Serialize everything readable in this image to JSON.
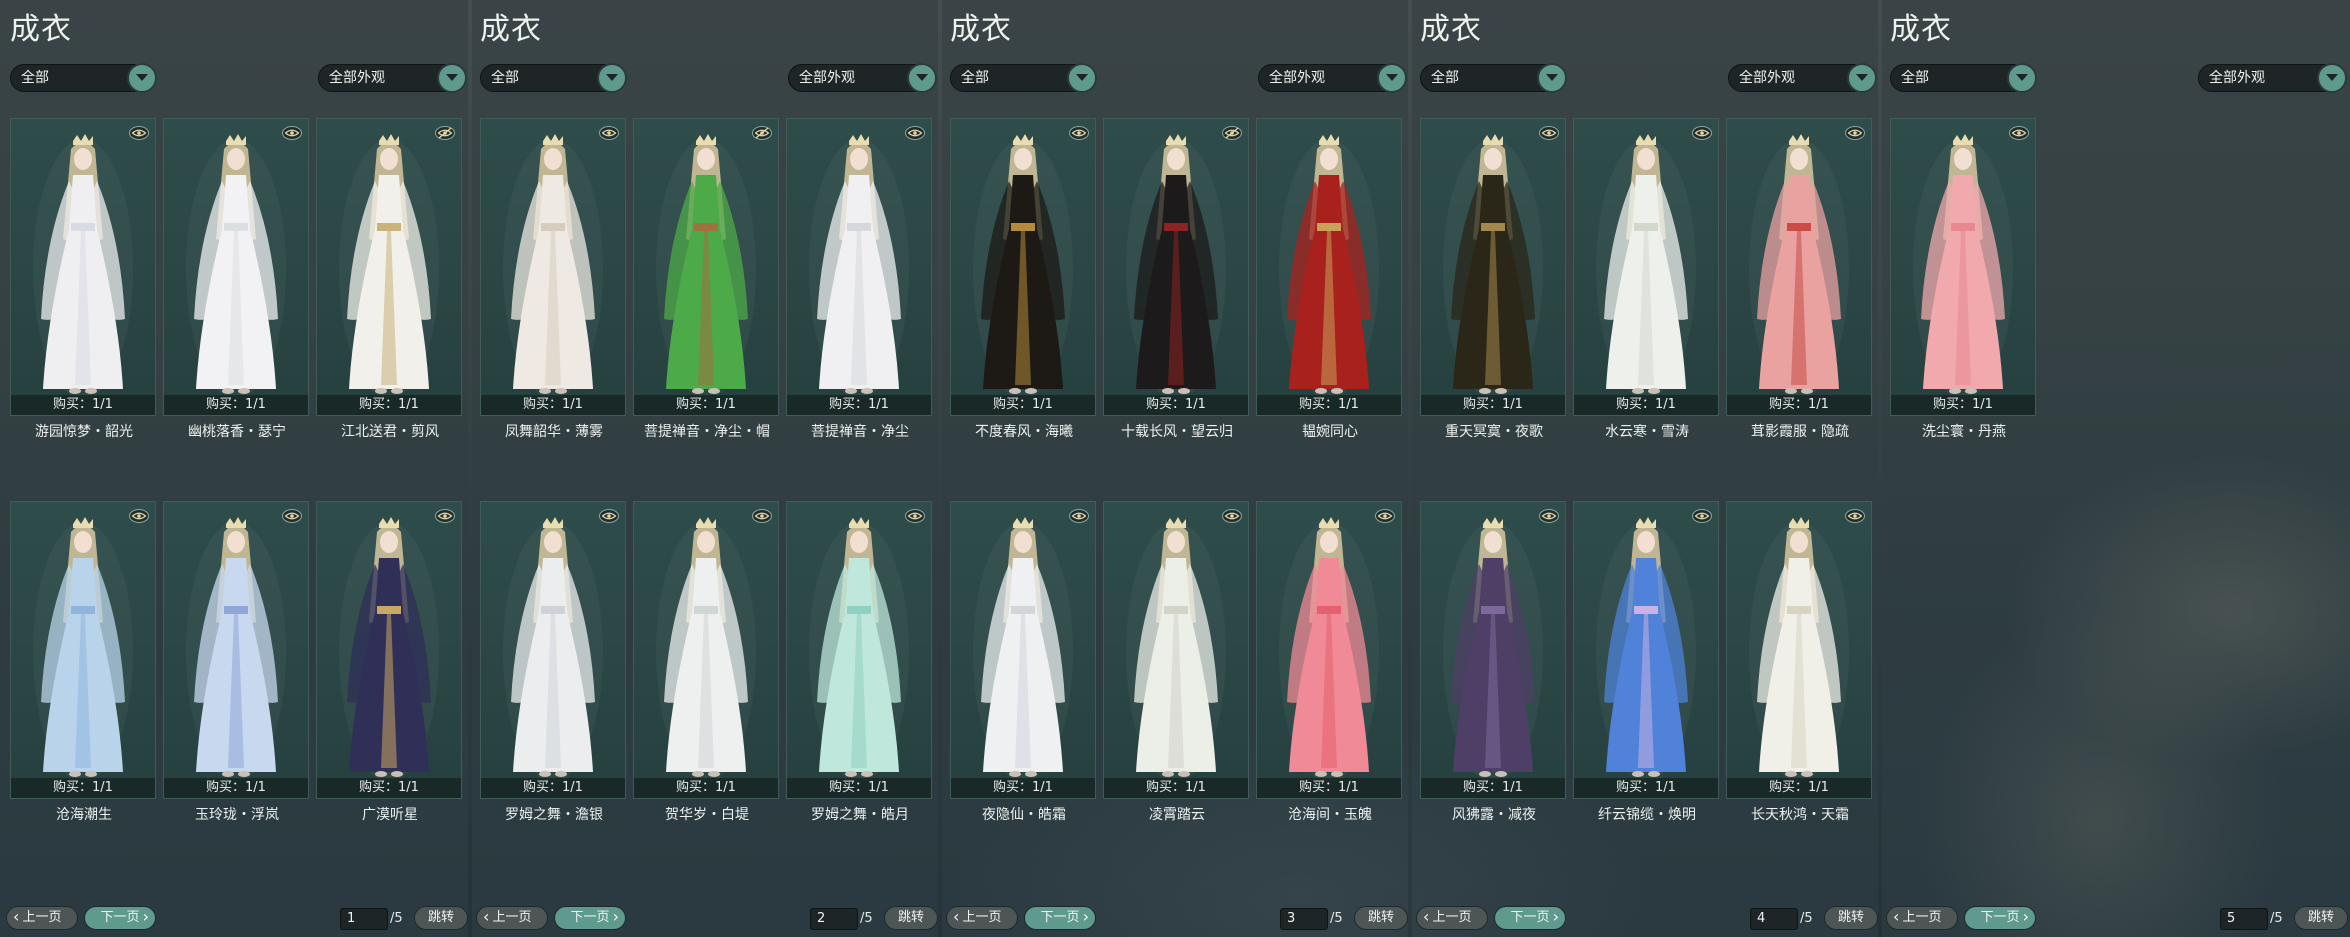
{
  "colors": {
    "accent": "#5f9a8f",
    "card_bg": "#2a4644",
    "background": "#2f3d42"
  },
  "pages": [
    {
      "title": "成衣",
      "filter_left": "全部",
      "filter_right": "全部外观",
      "prev_label": "上一页",
      "next_label": "下一页",
      "page_current": "1",
      "page_total": "/5",
      "jump_label": "跳转",
      "items": [
        {
          "name": "游园惊梦・韶光",
          "buy": "购买：1/1",
          "icon": "eye-icon",
          "palette": [
            "#efeff2",
            "#d9dbe4"
          ]
        },
        {
          "name": "幽桃落香・瑟宁",
          "buy": "购买：1/1",
          "icon": "eye-icon",
          "palette": [
            "#f2f2f4",
            "#dcdfe2"
          ]
        },
        {
          "name": "江北送君・剪风",
          "buy": "购买：1/1",
          "icon": "eye-crossed-icon",
          "palette": [
            "#f1f0ea",
            "#c8b37a"
          ]
        },
        {
          "name": "沧海潮生",
          "buy": "购买：1/1",
          "icon": "eye-icon",
          "palette": [
            "#b9d4ea",
            "#8fb5dc"
          ]
        },
        {
          "name": "玉玲珑・浮岚",
          "buy": "购买：1/1",
          "icon": "eye-icon",
          "palette": [
            "#c8d8ef",
            "#8ea7d6"
          ]
        },
        {
          "name": "广漠听星",
          "buy": "购买：1/1",
          "icon": "eye-icon",
          "palette": [
            "#2f2f58",
            "#c9a865"
          ]
        }
      ]
    },
    {
      "title": "成衣",
      "filter_left": "全部",
      "filter_right": "全部外观",
      "prev_label": "上一页",
      "next_label": "下一页",
      "page_current": "2",
      "page_total": "/5",
      "jump_label": "跳转",
      "items": [
        {
          "name": "凤舞韶华・薄雾",
          "buy": "购买：1/1",
          "icon": "eye-icon",
          "palette": [
            "#eee9e2",
            "#d8cdbd"
          ]
        },
        {
          "name": "菩提禅音・净尘・帽",
          "buy": "购买：1/1",
          "icon": "eye-crossed-icon",
          "palette": [
            "#4caa48",
            "#a07040"
          ]
        },
        {
          "name": "菩提禅音・净尘",
          "buy": "购买：1/1",
          "icon": "eye-icon",
          "palette": [
            "#f0f0f2",
            "#d6d8de"
          ]
        },
        {
          "name": "罗姆之舞・澹银",
          "buy": "购买：1/1",
          "icon": "eye-icon",
          "palette": [
            "#ecedef",
            "#cfd3d8"
          ]
        },
        {
          "name": "贺华岁・白堤",
          "buy": "购买：1/1",
          "icon": "eye-icon",
          "palette": [
            "#eef0f0",
            "#cfd6d6"
          ]
        },
        {
          "name": "罗姆之舞・皓月",
          "buy": "购买：1/1",
          "icon": "eye-icon",
          "palette": [
            "#bfe7dc",
            "#8fd0c0"
          ]
        }
      ]
    },
    {
      "title": "成衣",
      "filter_left": "全部",
      "filter_right": "全部外观",
      "prev_label": "上一页",
      "next_label": "下一页",
      "page_current": "3",
      "page_total": "/5",
      "jump_label": "跳转",
      "items": [
        {
          "name": "不度春风・海曦",
          "buy": "购买：1/1",
          "icon": "eye-icon",
          "palette": [
            "#1d1a16",
            "#b58a3c"
          ]
        },
        {
          "name": "十载长风・望云归",
          "buy": "购买：1/1",
          "icon": "eye-crossed-icon",
          "palette": [
            "#1c1a1a",
            "#8e2323"
          ]
        },
        {
          "name": "韫婉同心",
          "buy": "购买：1/1",
          "icon": "none",
          "palette": [
            "#a8211d",
            "#c9a25a"
          ]
        },
        {
          "name": "夜隐仙・皓霜",
          "buy": "购买：1/1",
          "icon": "eye-icon",
          "palette": [
            "#eef0f2",
            "#d2d6da"
          ]
        },
        {
          "name": "凌霄踏云",
          "buy": "购买：1/1",
          "icon": "eye-icon",
          "palette": [
            "#eceee8",
            "#d2d4c8"
          ]
        },
        {
          "name": "沧海间・玉魄",
          "buy": "购买：1/1",
          "icon": "eye-icon",
          "palette": [
            "#f08a96",
            "#e4606e"
          ]
        }
      ]
    },
    {
      "title": "成衣",
      "filter_left": "全部",
      "filter_right": "全部外观",
      "prev_label": "上一页",
      "next_label": "下一页",
      "page_current": "4",
      "page_total": "/5",
      "jump_label": "跳转",
      "items": [
        {
          "name": "重天冥寞・夜歌",
          "buy": "购买：1/1",
          "icon": "eye-icon",
          "palette": [
            "#2a2618",
            "#a4874a"
          ]
        },
        {
          "name": "水云寒・雪涛",
          "buy": "购买：1/1",
          "icon": "eye-icon",
          "palette": [
            "#eef0ec",
            "#d3d8cf"
          ]
        },
        {
          "name": "茸影霞服・隐疏",
          "buy": "购买：1/1",
          "icon": "eye-icon",
          "palette": [
            "#e9a2a0",
            "#c94c46"
          ]
        },
        {
          "name": "风狒露・减夜",
          "buy": "购买：1/1",
          "icon": "eye-icon",
          "palette": [
            "#4d3f66",
            "#7e6a9a"
          ]
        },
        {
          "name": "纤云锦缆・焕明",
          "buy": "购买：1/1",
          "icon": "eye-icon",
          "palette": [
            "#4f82d8",
            "#c9b3e6"
          ]
        },
        {
          "name": "长天秋鸿・天霜",
          "buy": "购买：1/1",
          "icon": "eye-icon",
          "palette": [
            "#f0efe8",
            "#d8d4c2"
          ]
        }
      ]
    },
    {
      "title": "成衣",
      "filter_left": "全部",
      "filter_right": "全部外观",
      "prev_label": "上一页",
      "next_label": "下一页",
      "page_current": "5",
      "page_total": "/5",
      "jump_label": "跳转",
      "items": [
        {
          "name": "洗尘寰・丹燕",
          "buy": "购买：1/1",
          "icon": "eye-icon",
          "palette": [
            "#f2a9ae",
            "#e88890"
          ]
        }
      ]
    }
  ]
}
